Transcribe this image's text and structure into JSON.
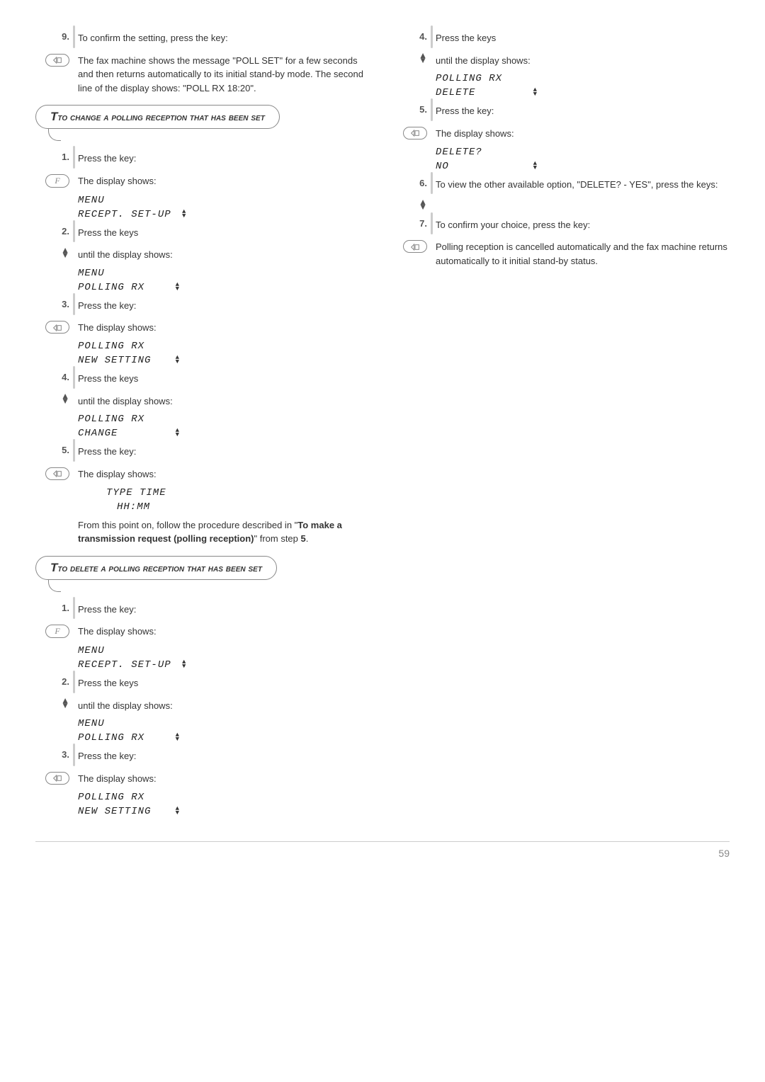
{
  "left": {
    "step9": {
      "num": "9.",
      "text": "To confirm the setting, press the key:",
      "desc": "The fax machine shows the message \"POLL SET\" for a few seconds and then returns automatically to its initial stand-by mode. The second line of the display shows: \"POLL RX   18:20\"."
    },
    "section_change": "To change a polling reception that has been set",
    "c1": {
      "num": "1.",
      "text": "Press the key:",
      "after": "The display shows:",
      "d1": "MENU",
      "d2": "RECEPT. SET-UP"
    },
    "c2": {
      "num": "2.",
      "text": "Press the keys",
      "after": "until the display shows:",
      "d1": "MENU",
      "d2": "POLLING RX"
    },
    "c3": {
      "num": "3.",
      "text": "Press the key:",
      "after": "The display shows:",
      "d1": "POLLING RX",
      "d2": "NEW SETTING"
    },
    "c4": {
      "num": "4.",
      "text": "Press the keys",
      "after": "until the display shows:",
      "d1": "POLLING RX",
      "d2": "CHANGE"
    },
    "c5": {
      "num": "5.",
      "text": "Press the key:",
      "after": "The display shows:",
      "d1": "TYPE TIME",
      "d2": "HH:MM",
      "note_pre": "From this point on, follow the procedure described in \"",
      "note_bold": "To make a transmission request (polling reception)",
      "note_post": "\" from step ",
      "note_step": "5",
      "note_end": "."
    },
    "section_delete": "To delete a polling reception that has been set",
    "d_s1": {
      "num": "1.",
      "text": "Press the key:",
      "after": "The display shows:",
      "d1": "MENU",
      "d2": "RECEPT. SET-UP"
    },
    "d_s2": {
      "num": "2.",
      "text": "Press the keys",
      "after": "until the display shows:",
      "d1": "MENU",
      "d2": "POLLING RX"
    },
    "d_s3": {
      "num": "3.",
      "text": "Press the key:",
      "after": "The display shows:",
      "d1": "POLLING RX",
      "d2": "NEW SETTING"
    }
  },
  "right": {
    "r4": {
      "num": "4.",
      "text": "Press the keys",
      "after": "until the display shows:",
      "d1": "POLLING RX",
      "d2": "DELETE"
    },
    "r5": {
      "num": "5.",
      "text": "Press the key:",
      "after": "The display shows:",
      "d1": "DELETE?",
      "d2": "NO"
    },
    "r6": {
      "num": "6.",
      "text": "To view the other available option, \"DELETE? - YES\", press the keys:"
    },
    "r7": {
      "num": "7.",
      "text": "To confirm your choice, press the key:",
      "desc": "Polling reception is cancelled automatically and the fax machine returns automatically to it initial stand-by status."
    }
  },
  "pagenum": "59"
}
